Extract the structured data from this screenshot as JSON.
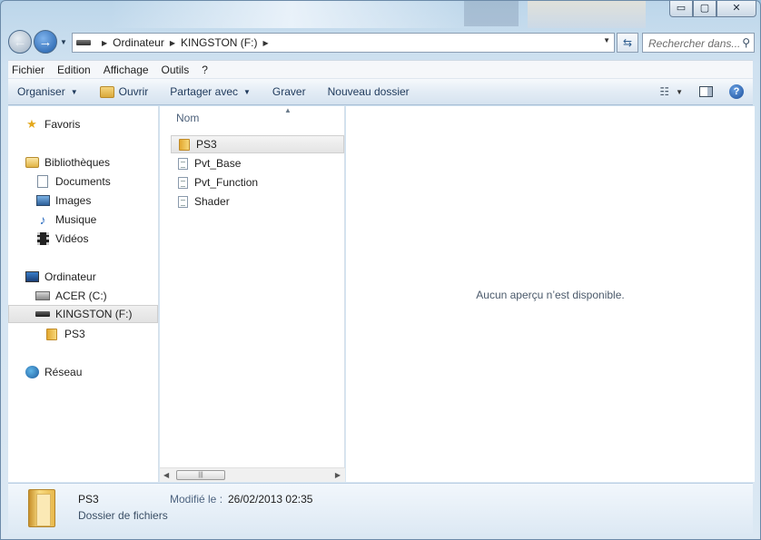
{
  "window": {
    "caption": {
      "minimize": "▭",
      "maximize": "▢",
      "close": "✕"
    }
  },
  "nav": {
    "breadcrumb": [
      "Ordinateur",
      "KINGSTON (F:)"
    ],
    "search_placeholder": "Rechercher dans..."
  },
  "menubar": [
    "Fichier",
    "Edition",
    "Affichage",
    "Outils",
    "?"
  ],
  "toolbar": {
    "organize": "Organiser",
    "open": "Ouvrir",
    "share": "Partager avec",
    "burn": "Graver",
    "new_folder": "Nouveau dossier"
  },
  "sidebar": {
    "favorites": "Favoris",
    "libraries": "Bibliothèques",
    "documents": "Documents",
    "images": "Images",
    "music": "Musique",
    "videos": "Vidéos",
    "computer": "Ordinateur",
    "drive_c": "ACER (C:)",
    "drive_f": "KINGSTON (F:)",
    "ps3": "PS3",
    "network": "Réseau"
  },
  "files": {
    "column_name": "Nom",
    "items": [
      {
        "name": "PS3",
        "kind": "folder"
      },
      {
        "name": "Pvt_Base",
        "kind": "file"
      },
      {
        "name": "Pvt_Function",
        "kind": "file"
      },
      {
        "name": "Shader",
        "kind": "file"
      }
    ]
  },
  "preview": {
    "empty_message": "Aucun aperçu n’est disponible."
  },
  "details": {
    "name": "PS3",
    "type": "Dossier de fichiers",
    "modified_label": "Modifié le :",
    "modified_value": "26/02/2013 02:35"
  }
}
